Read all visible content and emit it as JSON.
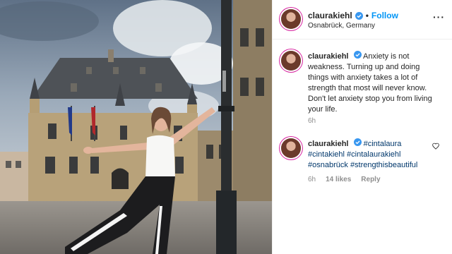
{
  "post": {
    "username": "claurakiehl",
    "follow_label": "Follow",
    "separator": "•",
    "location": "Osnabrück, Germany",
    "more_label": "···"
  },
  "caption": {
    "username": "claurakiehl",
    "text": "Anxiety is not weakness. Turning up and doing things with anxiety takes a lot of strength that most will never know. Don't let anxiety stop you from living your life.",
    "time": "6h"
  },
  "comment": {
    "username": "claurakiehl",
    "tags": [
      "#cintalaura",
      "#cintakiehl",
      "#cintalaurakiehl",
      "#osnabrück",
      "#strengthisbeautiful"
    ],
    "time": "6h",
    "likes": "14 likes",
    "reply_label": "Reply"
  },
  "colors": {
    "accent": "#0095f6",
    "hashtag": "#00376b",
    "muted": "#8e8e8e"
  }
}
